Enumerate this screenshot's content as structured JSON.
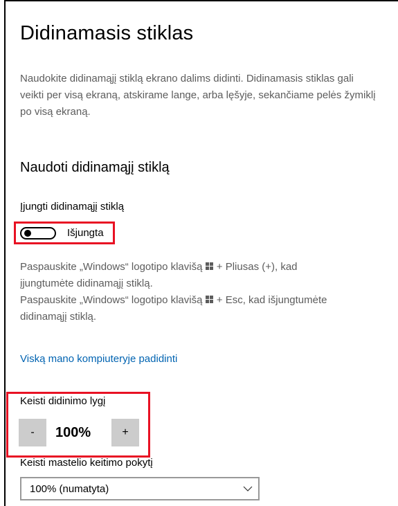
{
  "page": {
    "title": "Didinamasis stiklas",
    "description": "Naudokite didinamąjį stiklą ekrano dalims didinti. Didinamasis stiklas gali veikti per visą ekraną, atskirame lange, arba lęšyje, sekančiame pelės žymiklį po visą ekraną."
  },
  "section": {
    "title": "Naudoti didinamąjį stiklą"
  },
  "toggle": {
    "label": "Įjungti didinamąjį stiklą",
    "state_text": "Išjungta",
    "on": false
  },
  "hints": {
    "line1a": "Paspauskite „Windows“ logotipo klavišą ",
    "line1b": " + Pliusas (+), kad",
    "line2": "įjungtumėte didinamąjį stiklą.",
    "line3a": "Paspauskite „Windows“ logotipo klavišą ",
    "line3b": " + Esc, kad išjungtumėte",
    "line4": "didinamąjį stiklą."
  },
  "link": {
    "text": "Viską mano kompiuteryje padidinti"
  },
  "zoom": {
    "label": "Keisti didinimo lygį",
    "minus": "-",
    "value": "100%",
    "plus": "+"
  },
  "step": {
    "label": "Keisti mastelio keitimo pokytį",
    "selected": "100% (numatyta)"
  },
  "colors": {
    "highlight": "#e81123",
    "link": "#0063b1",
    "secondary_text": "#5c5c5c",
    "button_bg": "#cccccc"
  },
  "icons": {
    "windows_key": "windows-logo-icon",
    "dropdown": "chevron-down-icon"
  }
}
